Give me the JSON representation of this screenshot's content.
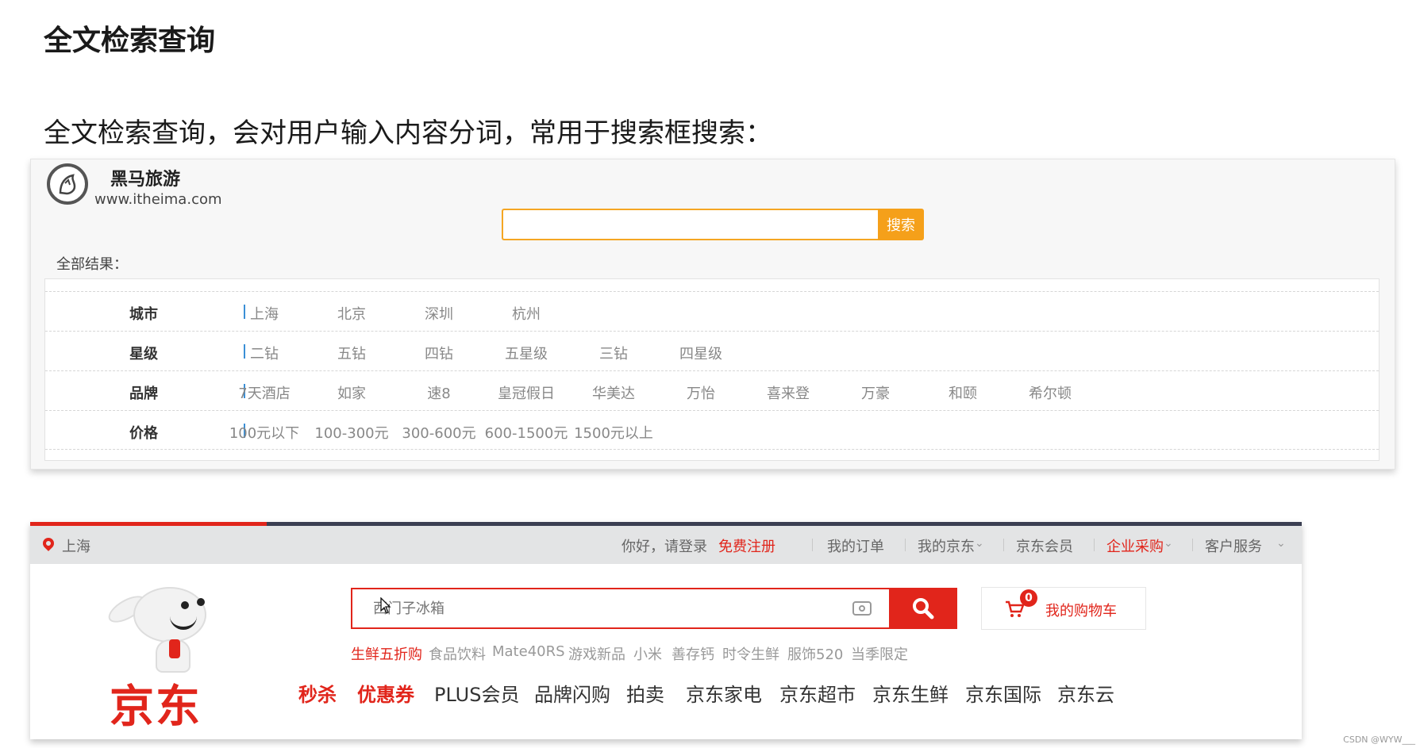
{
  "page": {
    "title": "全文检索查询",
    "description": "全文检索查询，会对用户输入内容分词，常用于搜索框搜索："
  },
  "heima": {
    "logo_icon": "horse-logo-icon",
    "brand": "黑马旅游",
    "url": "www.itheima.com",
    "search": {
      "value": "",
      "button_label": "搜索"
    },
    "results_label": "全部结果：",
    "filters": [
      {
        "label": "城市",
        "options": [
          "上海",
          "北京",
          "深圳",
          "杭州"
        ]
      },
      {
        "label": "星级",
        "options": [
          "二钻",
          "五钻",
          "四钻",
          "五星级",
          "三钻",
          "四星级"
        ]
      },
      {
        "label": "品牌",
        "options": [
          "7天酒店",
          "如家",
          "速8",
          "皇冠假日",
          "华美达",
          "万怡",
          "喜来登",
          "万豪",
          "和颐",
          "希尔顿"
        ]
      },
      {
        "label": "价格",
        "options": [
          "100元以下",
          "100-300元",
          "300-600元",
          "600-1500元",
          "1500元以上"
        ]
      }
    ]
  },
  "jd": {
    "location": "上海",
    "topbar": {
      "greeting": "你好，请登录",
      "register": "免费注册",
      "orders": "我的订单",
      "my_jd": "我的京东",
      "vip": "京东会员",
      "enterprise": "企业采购",
      "service": "客户服务"
    },
    "logo_text": "京东",
    "search": {
      "placeholder": "西门子冰箱"
    },
    "cart": {
      "label": "我的购物车",
      "count": "0"
    },
    "hotwords": [
      "生鲜五折购",
      "食品饮料",
      "Mate40RS",
      "游戏新品",
      "小米",
      "善存钙",
      "时令生鲜",
      "服饰520",
      "当季限定"
    ],
    "main_nav": [
      "秒杀",
      "优惠券",
      "PLUS会员",
      "品牌闪购",
      "拍卖",
      "京东家电",
      "京东超市",
      "京东生鲜",
      "京东国际",
      "京东云"
    ],
    "colors": {
      "brand_red": "#e1251b"
    }
  },
  "watermark": "CSDN @WYW___",
  "colors": {
    "heima_accent": "#f5a01a",
    "filter_separator": "#3a8fd6"
  }
}
